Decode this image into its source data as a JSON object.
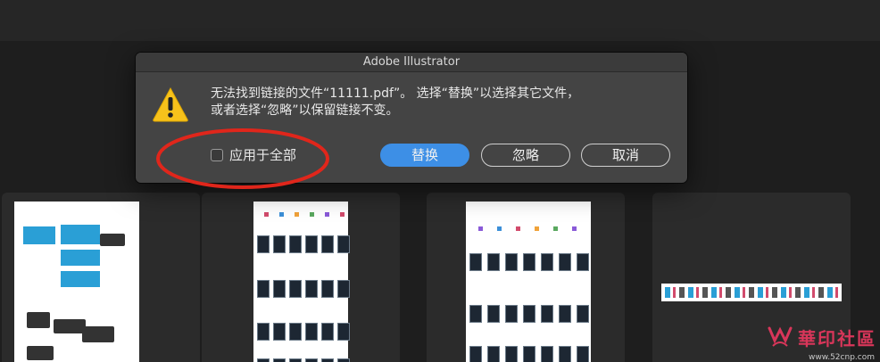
{
  "dialog": {
    "title": "Adobe Illustrator",
    "message_line1": "无法找到链接的文件“11111.pdf”。 选择“替换”以选择其它文件，",
    "message_line2": "或者选择“忽略”以保留链接不变。",
    "apply_all_label": "应用于全部",
    "apply_all_checked": false,
    "replace_label": "替换",
    "ignore_label": "忽略",
    "cancel_label": "取消"
  },
  "icons": {
    "warning": "warning-triangle-icon"
  },
  "colors": {
    "dialog_bg": "#444444",
    "primary_button": "#3d8fe6",
    "annotation": "#e0261b",
    "warning_yellow": "#f7c21b"
  },
  "watermark": {
    "text": "華印社區",
    "url": "www.52cnp.com"
  }
}
